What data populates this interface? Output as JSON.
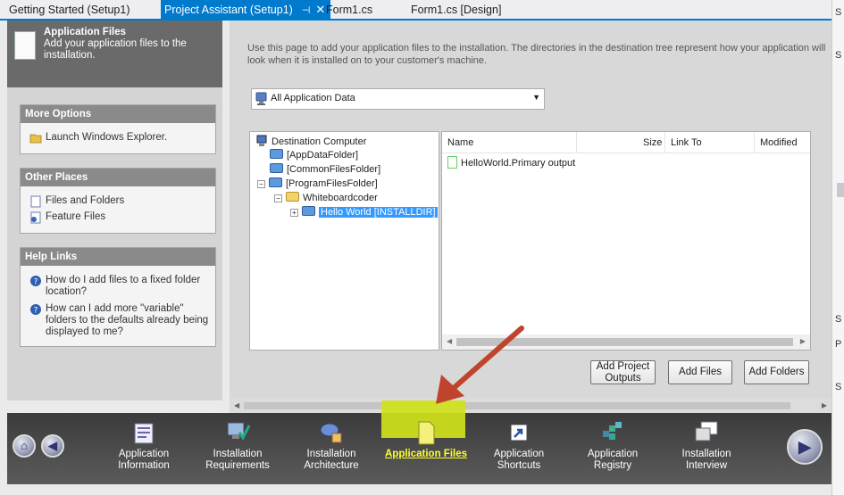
{
  "tabs": [
    {
      "label": "Getting Started (Setup1)"
    },
    {
      "label": "Project Assistant (Setup1)"
    },
    {
      "label": "Form1.cs"
    },
    {
      "label": "Form1.cs [Design]"
    }
  ],
  "right_panel": {
    "chars": [
      "S",
      "S",
      "S",
      "P",
      "S"
    ]
  },
  "header": {
    "title": "Application Files",
    "subtitle": "Add your application files to the installation."
  },
  "more_options": {
    "title": "More Options",
    "items": [
      {
        "label": "Launch Windows Explorer."
      }
    ]
  },
  "other_places": {
    "title": "Other Places",
    "items": [
      {
        "label": "Files and Folders"
      },
      {
        "label": "Feature Files"
      }
    ]
  },
  "help_links": {
    "title": "Help Links",
    "items": [
      {
        "label": "How do I add files to a fixed folder location?"
      },
      {
        "label": "How can I add more \"variable\" folders to the defaults already being displayed to me?"
      }
    ]
  },
  "description": "Use this page to add your application files to the installation. The directories in the destination tree represent how your application will look when it is installed on to your customer's machine.",
  "dropdown": {
    "value": "All Application Data"
  },
  "tree": {
    "nodes": [
      {
        "label": "Destination Computer"
      },
      {
        "label": "[AppDataFolder]"
      },
      {
        "label": "[CommonFilesFolder]"
      },
      {
        "label": "[ProgramFilesFolder]"
      },
      {
        "label": "Whiteboardcoder"
      },
      {
        "label": "Hello World [INSTALLDIR]"
      }
    ]
  },
  "list": {
    "columns": [
      "Name",
      "Size",
      "Link To",
      "Modified"
    ],
    "rows": [
      {
        "name": "HelloWorld.Primary output"
      }
    ]
  },
  "buttons": {
    "add_project_outputs": "Add Project Outputs",
    "add_files": "Add Files",
    "add_folders": "Add Folders"
  },
  "nav": [
    {
      "label": "Application Information"
    },
    {
      "label": "Installation Requirements"
    },
    {
      "label": "Installation Architecture"
    },
    {
      "label": "Application Files"
    },
    {
      "label": "Application Shortcuts"
    },
    {
      "label": "Application Registry"
    },
    {
      "label": "Installation Interview"
    }
  ],
  "colors": {
    "accent": "#007acc",
    "highlight": "#cfe21a",
    "arrow": "#c0432e"
  }
}
